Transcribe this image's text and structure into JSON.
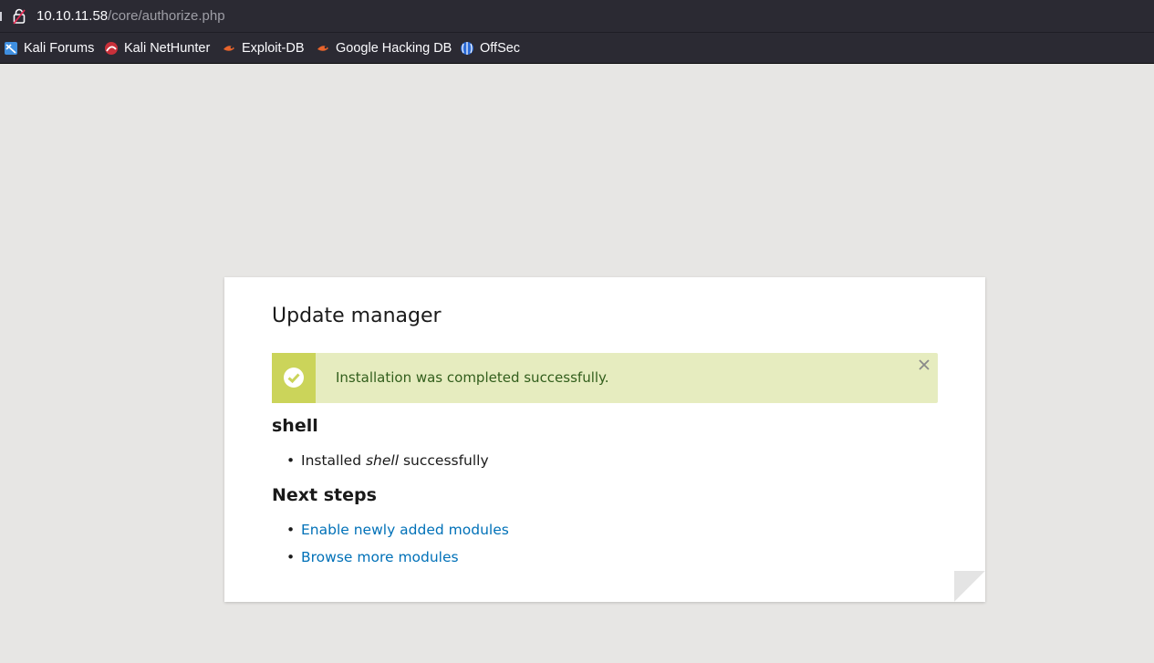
{
  "browser": {
    "url_host": "10.10.11.58",
    "url_path": "/core/authorize.php",
    "bookmarks": [
      {
        "label": "Kali Forums",
        "icon": "kali-forums-icon"
      },
      {
        "label": "Kali NetHunter",
        "icon": "kali-nethunter-icon"
      },
      {
        "label": "Exploit-DB",
        "icon": "exploit-db-icon"
      },
      {
        "label": "Google Hacking DB",
        "icon": "google-hacking-db-icon"
      },
      {
        "label": "OffSec",
        "icon": "offsec-icon"
      }
    ]
  },
  "page": {
    "title": "Update manager",
    "message": {
      "text": "Installation was completed successfully.",
      "type": "status",
      "icon": "check-circle-icon"
    },
    "module": {
      "heading": "shell",
      "item_prefix": "Installed ",
      "item_name": "shell",
      "item_suffix": " successfully"
    },
    "next_steps": {
      "heading": "Next steps",
      "links": [
        "Enable newly added modules",
        "Browse more modules"
      ]
    }
  },
  "colors": {
    "accent_link": "#0071b8",
    "status_bg": "#e6ecbf",
    "status_side": "#cbd45a",
    "status_text": "#325e1c",
    "page_bg": "#e7e6e4",
    "chrome_bg": "#2b2a33"
  }
}
